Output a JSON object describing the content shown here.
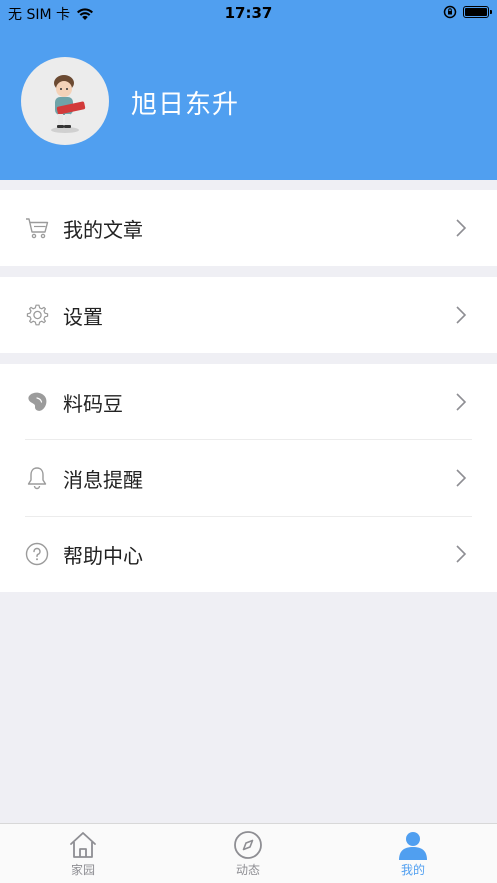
{
  "status_bar": {
    "carrier": "无 SIM 卡",
    "time": "17:37"
  },
  "profile": {
    "username": "旭日东升"
  },
  "menu": {
    "group1": [
      {
        "label": "我的文章",
        "icon": "cart-icon"
      }
    ],
    "group2": [
      {
        "label": "设置",
        "icon": "gear-icon"
      }
    ],
    "group3": [
      {
        "label": "料码豆",
        "icon": "bean-icon"
      },
      {
        "label": "消息提醒",
        "icon": "bell-icon"
      },
      {
        "label": "帮助中心",
        "icon": "help-icon"
      }
    ]
  },
  "tabbar": {
    "tabs": [
      {
        "label": "家园",
        "icon": "home-icon",
        "active": false
      },
      {
        "label": "动态",
        "icon": "compass-icon",
        "active": false
      },
      {
        "label": "我的",
        "icon": "person-icon",
        "active": true
      }
    ]
  },
  "colors": {
    "accent": "#509ff0",
    "background": "#efeff4",
    "text": "#222222",
    "inactive": "#8e8e93"
  }
}
